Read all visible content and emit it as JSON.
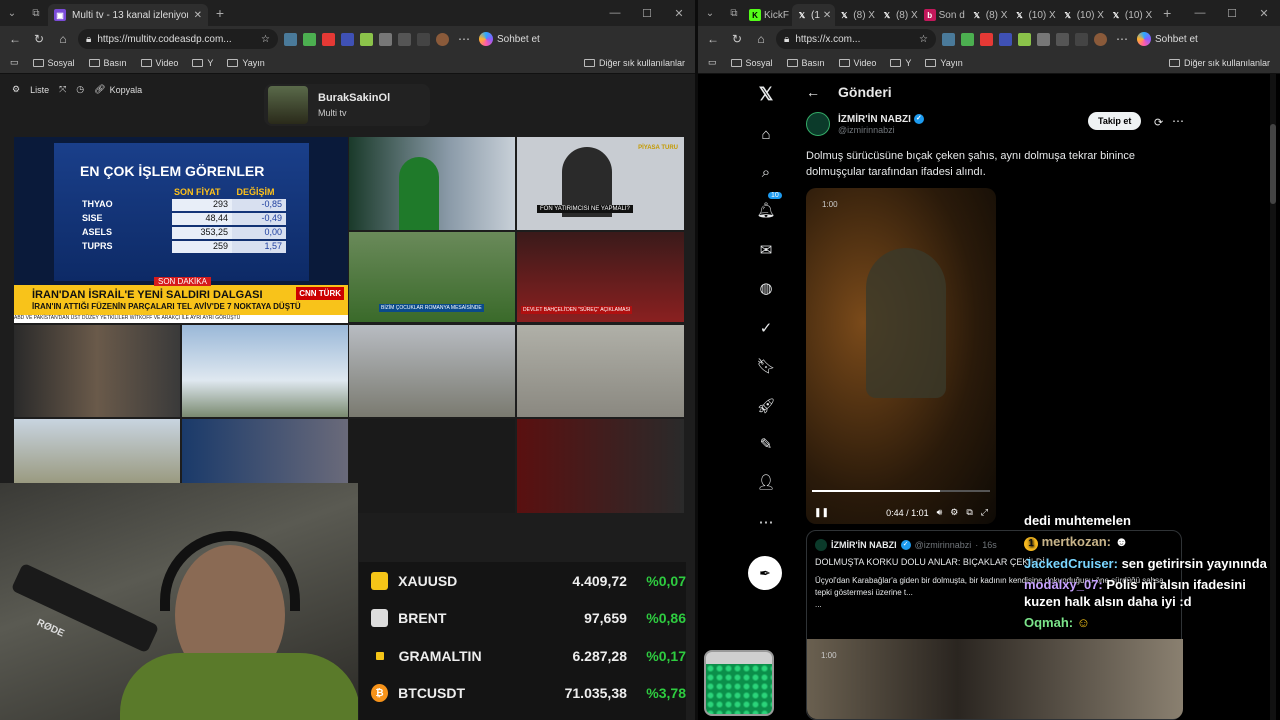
{
  "left_window": {
    "tabs": [
      {
        "title": "Multi tv - 13 kanal izleniyor",
        "active": true
      }
    ],
    "url": "https://multitv.codeasdp.com...",
    "copilot_label": "Sohbet et",
    "bookmarks": [
      "Sosyal",
      "Basın",
      "Video",
      "Y",
      "Yayın"
    ],
    "bookmarks_right": "Diğer sık kullanılanlar",
    "app_toolbar": {
      "list": "Liste",
      "copy": "Kopyala"
    },
    "profile": {
      "name": "BurakSakinOl",
      "subtitle": "Multi tv"
    },
    "tv_main": {
      "title": "EN ÇOK İŞLEM GÖRENLER",
      "col_price": "SON FİYAT",
      "col_change": "DEĞİŞİM",
      "rows": [
        {
          "sym": "THYAO",
          "price": "293",
          "chg": "-0,85"
        },
        {
          "sym": "SISE",
          "price": "48,44",
          "chg": "-0,49"
        },
        {
          "sym": "ASELS",
          "price": "353,25",
          "chg": "0,00"
        },
        {
          "sym": "TUPRS",
          "price": "259",
          "chg": "1,57"
        }
      ],
      "breaking_label": "SON DAKİKA",
      "headline": "İRAN'DAN İSRAİL'E YENİ SALDIRI DALGASI",
      "subheadline": "İRAN'IN ATTIĞI FÜZENİN PARÇALARI TEL AVİV'DE 7 NOKTAYA DÜŞTÜ",
      "ticker": "ABD VE PAKİSTAN'DAN ÜST DÜZEY YETKİLİLER WİTKOFF VE ARAKÇI İLE AYRI AYRI GÖRÜŞTÜ",
      "logo": "CNN TÜRK"
    },
    "tv_small_captions": {
      "fon": "FON YATIRIMCISI NE YAPMALI?",
      "piyasa": "PİYASA TURU",
      "cocuklar": "BİZİM ÇOCUKLAR ROMANYA MESAİSİNDE",
      "bahceli": "DEVLET BAHÇELİ'DEN \"SÜREÇ\" AÇIKLAMASI"
    },
    "prices": [
      {
        "sym": "XAUUSD",
        "val": "4.409,72",
        "pct": "%0,07",
        "color": "#f5c518"
      },
      {
        "sym": "BRENT",
        "val": "97,659",
        "pct": "%0,86",
        "color": "#dddddd"
      },
      {
        "sym": "GRAMALTIN",
        "val": "6.287,28",
        "pct": "%0,17",
        "color": "#f5c518"
      },
      {
        "sym": "BTCUSDT",
        "val": "71.035,38",
        "pct": "%3,78",
        "color": "#f7931a"
      }
    ],
    "cam_mic_label": "RØDE"
  },
  "right_window": {
    "tabs": [
      "KickF",
      "(1",
      "(8) X",
      "(8) X",
      "Son d",
      "(8) X",
      "(10) X",
      "(10) X",
      "(10) X"
    ],
    "url": "https://x.com...",
    "copilot_label": "Sohbet et",
    "bookmarks": [
      "Sosyal",
      "Basın",
      "Video",
      "Y",
      "Yayın"
    ],
    "bookmarks_right": "Diğer sık kullanılanlar",
    "header": "Gönderi",
    "notification_count": "10",
    "author": {
      "name": "İZMİR'İN NABZI",
      "handle": "@izmirinnabzi"
    },
    "follow_label": "Takip et",
    "tweet_text": "Dolmuş sürücüsüne bıçak çeken şahıs, aynı dolmuşa tekrar binince dolmuşçular tarafından ifadesi alındı.",
    "video": {
      "top_time": "1:00",
      "time": "0:44 / 1:01",
      "progress": 0.72
    },
    "quote": {
      "name": "İZMİR'İN NABZI",
      "handle": "@izmirinnabzi",
      "age": "16s",
      "title": "DOLMUŞTA KORKU DOLU ANLAR: BIÇAKLAR ÇEKİLDİ",
      "body": "Üçyol'dan Karabağlar'a giden bir dolmuşta, bir kadının kendisine dokunduğunu öne sürdüğü şahsa tepki göstermesi üzerine t...",
      "more": "...",
      "media_time": "1:00"
    }
  },
  "chat": [
    {
      "user": "",
      "text": "dedi muhtemelen"
    },
    {
      "user": "mertkozan:",
      "text": ""
    },
    {
      "user": "JackedCruiser:",
      "text": "sen getirirsin yayınında"
    },
    {
      "user": "modalxy_07:",
      "text": "Polis mi alsın ifadesini kuzen halk alsın daha iyi :d"
    },
    {
      "user": "Oqmah:",
      "text": ""
    }
  ]
}
